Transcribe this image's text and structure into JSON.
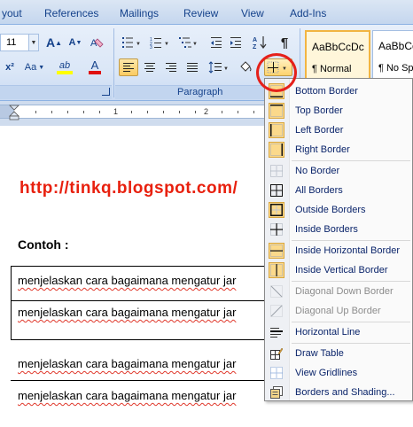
{
  "tabs": {
    "layout_partial": "yout",
    "references": "References",
    "mailings": "Mailings",
    "review": "Review",
    "view": "View",
    "addins": "Add-Ins"
  },
  "ribbon": {
    "font_size": "11",
    "grow_font": "A",
    "shrink_font": "A",
    "change_case": "Aa",
    "highlight": "ab",
    "font_color": "A",
    "superscript": "x²",
    "group_paragraph": "Paragraph",
    "show_marks": "¶",
    "styles": [
      {
        "sample": "AaBbCcDc",
        "name": "¶ Normal"
      },
      {
        "sample": "AaBbCcDc",
        "name": "¶ No Spa"
      }
    ]
  },
  "ruler": {
    "numbers": [
      "1",
      "2"
    ]
  },
  "document": {
    "url_text": "http://tinkq.blogspot.com/",
    "heading": "Contoh :",
    "lines": [
      "menjelaskan cara bagaimana mengatur jar",
      "menjelaskan cara bagaimana mengatur jar",
      "menjelaskan cara bagaimana mengatur jar",
      "menjelaskan cara bagaimana mengatur jar"
    ]
  },
  "menu": {
    "items": [
      {
        "label": "Bottom Border",
        "icon": "bottom-border-icon",
        "disabled": false
      },
      {
        "label": "Top Border",
        "icon": "top-border-icon",
        "disabled": false
      },
      {
        "label": "Left Border",
        "icon": "left-border-icon",
        "disabled": false
      },
      {
        "label": "Right Border",
        "icon": "right-border-icon",
        "disabled": false
      },
      {
        "label": "No Border",
        "icon": "no-border-icon",
        "disabled": false
      },
      {
        "label": "All Borders",
        "icon": "all-borders-icon",
        "disabled": false
      },
      {
        "label": "Outside Borders",
        "icon": "outside-borders-icon",
        "disabled": false
      },
      {
        "label": "Inside Borders",
        "icon": "inside-borders-icon",
        "disabled": false
      },
      {
        "label": "Inside Horizontal Border",
        "icon": "inside-horizontal-border-icon",
        "disabled": false
      },
      {
        "label": "Inside Vertical Border",
        "icon": "inside-vertical-border-icon",
        "disabled": false
      },
      {
        "label": "Diagonal Down Border",
        "icon": "diagonal-down-border-icon",
        "disabled": true
      },
      {
        "label": "Diagonal Up Border",
        "icon": "diagonal-up-border-icon",
        "disabled": true
      },
      {
        "label": "Horizontal Line",
        "icon": "horizontal-line-icon",
        "disabled": false
      },
      {
        "label": "Draw Table",
        "icon": "draw-table-icon",
        "disabled": false
      },
      {
        "label": "View Gridlines",
        "icon": "view-gridlines-icon",
        "disabled": false
      },
      {
        "label": "Borders and Shading...",
        "icon": "borders-and-shading-icon",
        "disabled": false
      }
    ]
  },
  "colors": {
    "url_red": "#e8200e",
    "annotation_circle": "#e5201a",
    "selected_orange": "#fbcb62"
  }
}
